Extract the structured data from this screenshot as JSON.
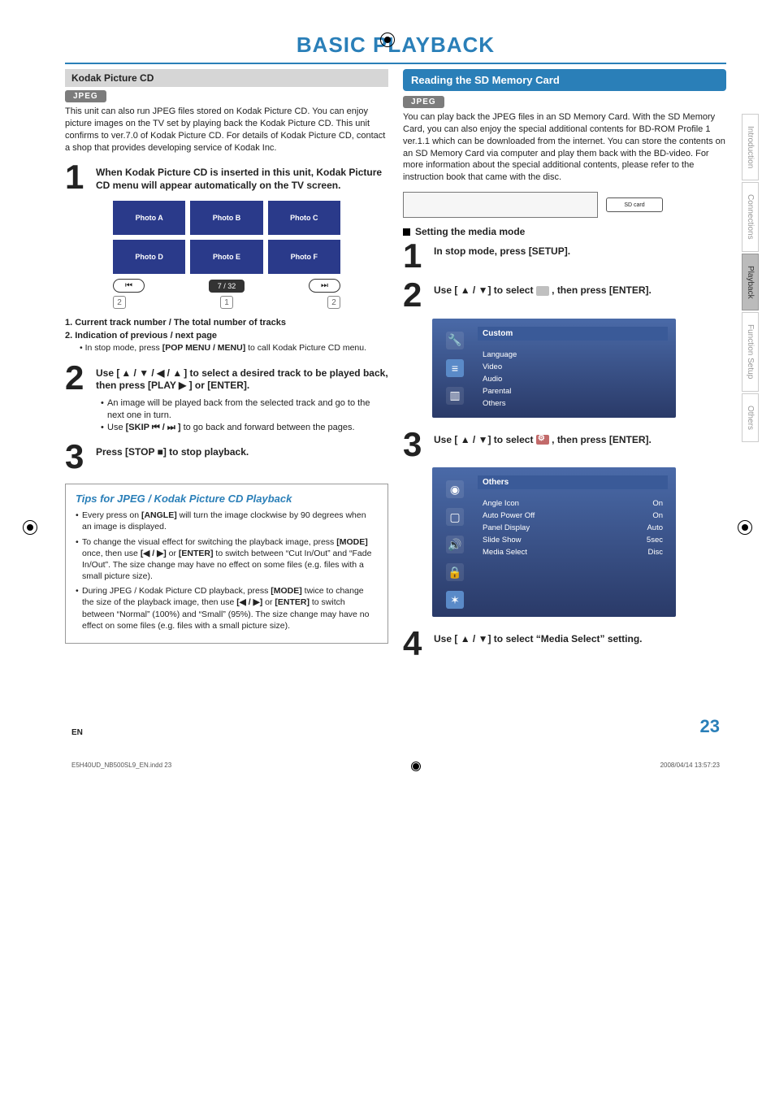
{
  "header": {
    "title": "BASIC PLAYBACK"
  },
  "left": {
    "kodak_heading": "Kodak Picture CD",
    "jpeg_tag": "JPEG",
    "intro": "This unit can also run JPEG files stored on Kodak Picture CD. You can enjoy picture images on the TV set by playing back the Kodak Picture CD. This unit confirms to ver.7.0 of Kodak Picture CD. For details of Kodak Picture CD, contact a shop that provides developing service of Kodak Inc.",
    "step1_num": "1",
    "step1_text": "When Kodak Picture CD is inserted in this unit, Kodak Picture CD menu will appear automatically on the TV screen.",
    "photo_a": "Photo A",
    "photo_b": "Photo B",
    "photo_c": "Photo C",
    "photo_d": "Photo D",
    "photo_e": "Photo E",
    "photo_f": "Photo F",
    "nav_prev": "⏮",
    "nav_count": "7 /   32",
    "nav_next": "⏭",
    "anno1": "2",
    "anno2": "1",
    "anno3": "2",
    "list1": "1.  Current track number / The total number of tracks",
    "list2": "2.  Indication of previous / next page",
    "list2_sub_a": "• In stop mode, press ",
    "list2_sub_b": "[POP MENU / MENU]",
    "list2_sub_c": " to call Kodak Picture CD menu.",
    "step2_num": "2",
    "step2_text_a": "Use [",
    "step2_text_b": "] to select a desired track to be played back, then press [PLAY ▶ ] or [ENTER].",
    "step2_arrows": "▲ / ▼ / ◀ / ▲",
    "step2_b1": "An image will be played back from the selected track and go to the next one in turn.",
    "step2_b2a": "Use ",
    "step2_b2b": "[SKIP ⏮ / ⏭ ]",
    "step2_b2c": " to go back and forward between the pages.",
    "step3_num": "3",
    "step3_text": "Press [STOP ■] to stop playback.",
    "tips_title": "Tips for JPEG / Kodak Picture CD Playback",
    "tip1a": "Every press on ",
    "tip1b": "[ANGLE]",
    "tip1c": " will turn the image clockwise by 90 degrees when an image is displayed.",
    "tip2a": "To change the visual effect for switching the playback image, press ",
    "tip2b": "[MODE]",
    "tip2c": " once, then use ",
    "tip2d": "[◀ / ▶]",
    "tip2e": " or ",
    "tip2f": "[ENTER]",
    "tip2g": " to switch between “Cut In/Out” and “Fade In/Out”. The size change may have no effect on some files (e.g. files with a small picture size).",
    "tip3a": "During JPEG / Kodak Picture CD playback, press ",
    "tip3b": "[MODE]",
    "tip3c": " twice to change the size of the playback image, then use ",
    "tip3d": "[◀ / ▶]",
    "tip3e": " or ",
    "tip3f": "[ENTER]",
    "tip3g": " to switch between “Normal” (100%) and “Small” (95%). The size change may have no effect on some files (e.g. files with a small picture size)."
  },
  "right": {
    "section_heading": "Reading the SD Memory Card",
    "jpeg_tag": "JPEG",
    "intro": "You can play back the JPEG files in an SD Memory Card. With the SD Memory Card, you can also enjoy the special additional contents for BD-ROM Profile 1 ver.1.1 which can be downloaded from the internet. You can store the contents on an SD Memory Card via computer and play them back with the BD-video. For more information about the special additional contents, please refer to the instruction book that came with the disc.",
    "sd_label": "SD card",
    "setting_mode_head": "Setting the media mode",
    "r1_num": "1",
    "r1_text": "In stop mode, press [SETUP].",
    "r2_num": "2",
    "r2_text_a": "Use [ ",
    "r2_arrows": "▲ / ▼",
    "r2_text_b": "] to select ",
    "r2_text_c": " , then press [ENTER].",
    "osd1_title": "Custom",
    "osd1_items": [
      "Language",
      "Video",
      "Audio",
      "Parental",
      "Others"
    ],
    "r3_num": "3",
    "r3_text_a": "Use [ ",
    "r3_arrows": "▲ / ▼",
    "r3_text_b": "] to select ",
    "r3_text_c": " , then press [ENTER].",
    "osd2_title": "Others",
    "osd2_rows": [
      {
        "label": "Angle Icon",
        "val": "On"
      },
      {
        "label": "Auto Power Off",
        "val": "On"
      },
      {
        "label": "Panel Display",
        "val": "Auto"
      },
      {
        "label": "Slide Show",
        "val": "5sec"
      },
      {
        "label": "Media Select",
        "val": "Disc"
      }
    ],
    "r4_num": "4",
    "r4_text_a": "Use [ ",
    "r4_arrows": "▲ / ▼",
    "r4_text_b": "] to select “Media Select” setting."
  },
  "tabs": [
    "Introduction",
    "Connections",
    "Playback",
    "Function Setup",
    "Others"
  ],
  "footer": {
    "en": "EN",
    "page": "23",
    "fileline": "E5H40UD_NB500SL9_EN.indd   23",
    "timestamp": "2008/04/14   13:57:23"
  }
}
